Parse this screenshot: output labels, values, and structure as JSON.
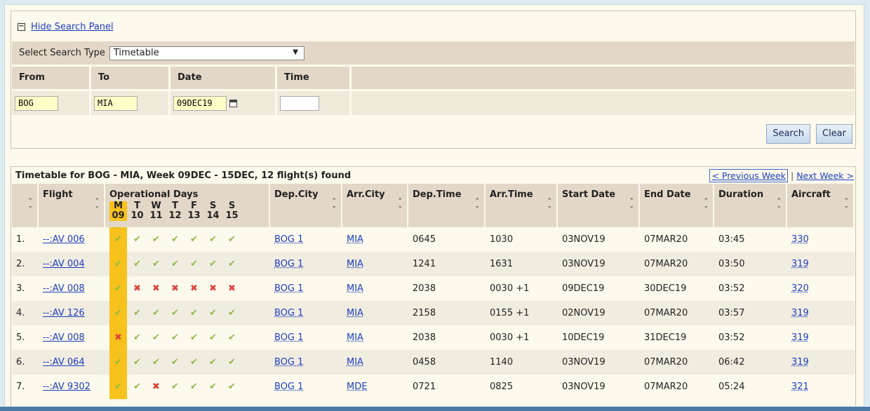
{
  "search_panel": {
    "hide_link": "Hide Search Panel",
    "toggle_symbol": "−",
    "type_label": "Select Search Type",
    "type_value": "Timetable",
    "headers": [
      "From",
      "To",
      "Date",
      "Time"
    ],
    "from_value": "BOG",
    "to_value": "MIA",
    "date_value": "09DEC19",
    "time_value": "",
    "search_button": "Search",
    "clear_button": "Clear"
  },
  "results": {
    "title": "Timetable for BOG - MIA, Week 09DEC - 15DEC, 12 flight(s) found",
    "prev_week": "< Previous Week",
    "separator": "|",
    "next_week": "Next Week >",
    "columns": {
      "flight": "Flight",
      "operational_days": "Operational Days",
      "dep_city": "Dep.City",
      "arr_city": "Arr.City",
      "dep_time": "Dep.Time",
      "arr_time": "Arr.Time",
      "start_date": "Start Date",
      "end_date": "End Date",
      "duration": "Duration",
      "aircraft": "Aircraft"
    },
    "day_letters": [
      "M",
      "T",
      "W",
      "T",
      "F",
      "S",
      "S"
    ],
    "day_numbers": [
      "09",
      "10",
      "11",
      "12",
      "13",
      "14",
      "15"
    ],
    "rows": [
      {
        "num": "1.",
        "flight": "--:AV 006",
        "days": [
          1,
          1,
          1,
          1,
          1,
          1,
          1
        ],
        "dep_city": "BOG 1",
        "arr_city": "MIA",
        "dep_time": "0645",
        "arr_time": "1030",
        "start": "03NOV19",
        "end": "07MAR20",
        "duration": "03:45",
        "aircraft": "330"
      },
      {
        "num": "2.",
        "flight": "--:AV 004",
        "days": [
          1,
          1,
          1,
          1,
          1,
          1,
          1
        ],
        "dep_city": "BOG 1",
        "arr_city": "MIA",
        "dep_time": "1241",
        "arr_time": "1631",
        "start": "03NOV19",
        "end": "07MAR20",
        "duration": "03:50",
        "aircraft": "319"
      },
      {
        "num": "3.",
        "flight": "--:AV 008",
        "days": [
          1,
          0,
          0,
          0,
          0,
          0,
          0
        ],
        "dep_city": "BOG 1",
        "arr_city": "MIA",
        "dep_time": "2038",
        "arr_time": "0030 +1",
        "start": "09DEC19",
        "end": "30DEC19",
        "duration": "03:52",
        "aircraft": "320"
      },
      {
        "num": "4.",
        "flight": "--:AV 126",
        "days": [
          1,
          1,
          1,
          1,
          1,
          1,
          1
        ],
        "dep_city": "BOG 1",
        "arr_city": "MIA",
        "dep_time": "2158",
        "arr_time": "0155 +1",
        "start": "02NOV19",
        "end": "07MAR20",
        "duration": "03:57",
        "aircraft": "319"
      },
      {
        "num": "5.",
        "flight": "--:AV 008",
        "days": [
          0,
          1,
          1,
          1,
          1,
          1,
          1
        ],
        "dep_city": "BOG 1",
        "arr_city": "MIA",
        "dep_time": "2038",
        "arr_time": "0030 +1",
        "start": "10DEC19",
        "end": "31DEC19",
        "duration": "03:52",
        "aircraft": "319"
      },
      {
        "num": "6.",
        "flight": "--:AV 064",
        "days": [
          1,
          1,
          1,
          1,
          1,
          1,
          1
        ],
        "dep_city": "BOG 1",
        "arr_city": "MIA",
        "dep_time": "0458",
        "arr_time": "1140",
        "start": "03NOV19",
        "end": "07MAR20",
        "duration": "06:42",
        "aircraft": "319"
      },
      {
        "num": "7.",
        "flight": "--:AV 9302",
        "days": [
          1,
          1,
          0,
          1,
          1,
          1,
          1
        ],
        "dep_city": "BOG 1",
        "arr_city": "MDE",
        "dep_time": "0721",
        "arr_time": "0825",
        "start": "03NOV19",
        "end": "07MAR20",
        "duration": "05:24",
        "aircraft": "321"
      }
    ]
  },
  "icons": {
    "check": "✔",
    "cross": "✖",
    "sort": "⌃⌄",
    "dropdown": "▼"
  }
}
